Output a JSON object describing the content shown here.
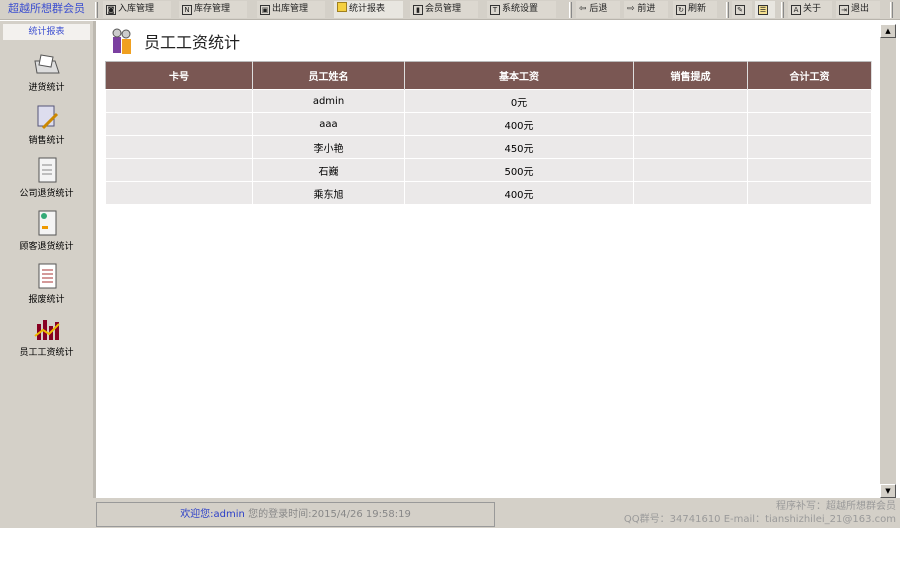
{
  "app": {
    "title": "超越所想群会员"
  },
  "toolbar": {
    "items": [
      {
        "label": "入库管理",
        "icon": "◙"
      },
      {
        "label": "库存管理",
        "icon": "N"
      },
      {
        "label": "出库管理",
        "icon": "▣"
      },
      {
        "label": "统计报表",
        "icon": "folder"
      },
      {
        "label": "会员管理",
        "icon": "▮"
      },
      {
        "label": "系统设置",
        "icon": "T"
      }
    ],
    "nav": [
      {
        "label": "后退",
        "icon": "⇦"
      },
      {
        "label": "前进",
        "icon": "⇨"
      },
      {
        "label": "刷新",
        "icon": "↻"
      }
    ],
    "extra": [
      {
        "label": "关于",
        "icon": "A"
      },
      {
        "label": "退出",
        "icon": "⇥"
      }
    ]
  },
  "sidebar": {
    "title": "统计报表",
    "items": [
      {
        "label": "进货统计"
      },
      {
        "label": "销售统计"
      },
      {
        "label": "公司退货统计"
      },
      {
        "label": "顾客退货统计"
      },
      {
        "label": "报废统计"
      },
      {
        "label": "员工工资统计"
      }
    ]
  },
  "main": {
    "title": "员工工资统计",
    "columns": [
      "卡号",
      "员工姓名",
      "基本工资",
      "销售提成",
      "合计工资"
    ],
    "rows": [
      [
        "",
        "admin",
        "0元",
        "",
        ""
      ],
      [
        "",
        "aaa",
        "400元",
        "",
        ""
      ],
      [
        "",
        "李小艳",
        "450元",
        "",
        ""
      ],
      [
        "",
        "石巍",
        "500元",
        "",
        ""
      ],
      [
        "",
        "乘东旭",
        "400元",
        "",
        ""
      ]
    ]
  },
  "status": {
    "welcome": "欢迎您:admin",
    "login": "您的登录时间:2015/4/26 19:58:19",
    "credit1": "程序补写：超越所想群会员",
    "credit2": "QQ群号：34741610 E-mail：tianshizhilei_21@163.com"
  },
  "colors": {
    "header": "#7a5753",
    "accent": "#3b4ed0"
  }
}
